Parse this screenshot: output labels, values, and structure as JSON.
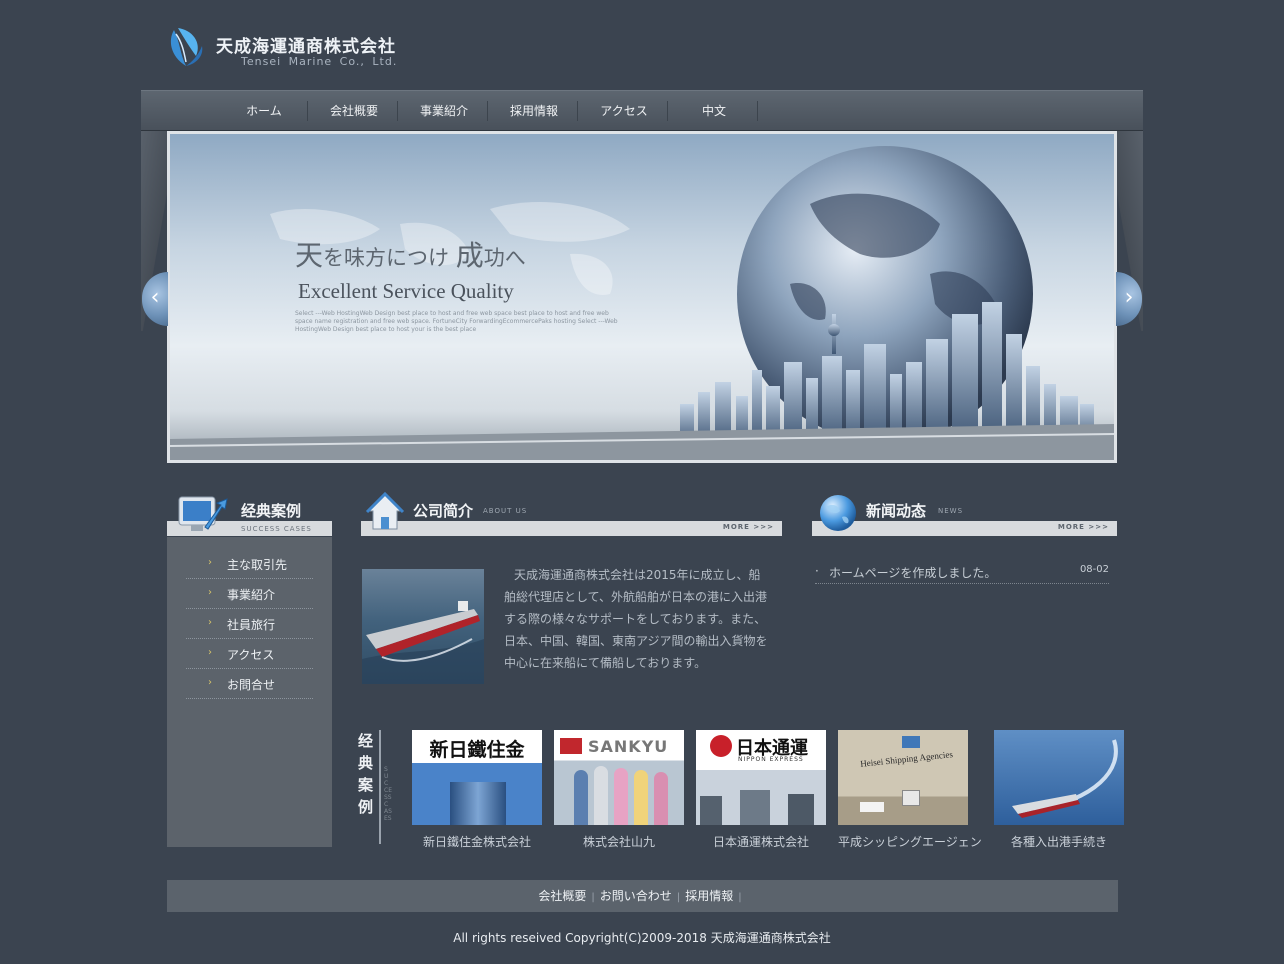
{
  "header": {
    "company_jp": "天成海運通商株式会社",
    "company_en": "Tensei Marine Co., Ltd."
  },
  "nav": {
    "items": [
      "ホーム",
      "会社概要",
      "事業紹介",
      "採用情報",
      "アクセス",
      "中文"
    ]
  },
  "banner": {
    "headline_1": "天",
    "headline_2": "を味方につけ ",
    "headline_3": "成",
    "headline_4": "功へ",
    "subtitle": "Excellent Service Quality",
    "small_text": "Select ---Web HostingWeb Design best place to host and free web space best place to host and free web space name registration and free web space. FortuneCity ForwardingEcommercePaks hosting Select ---Web HostingWeb Design best place to host your is the best place",
    "prev_glyph": "‹",
    "next_glyph": "›"
  },
  "cases_panel": {
    "title": "经典案例",
    "subtitle": "SUCCESS CASES",
    "items": [
      "主な取引先",
      "事業紹介",
      "社員旅行",
      "アクセス",
      "お問合せ"
    ]
  },
  "about": {
    "title": "公司简介",
    "subtitle": "ABOUT US",
    "more": "MORE >>>",
    "text": "天成海運通商株式会社は2015年に成立し、船舶総代理店として、外航船舶が日本の港に入出港する際の様々なサポートをしております。また、日本、中国、韓国、東南アジア間の輸出入貨物を中心に在来船にて備船しております。"
  },
  "news": {
    "title": "新闻动态",
    "subtitle": "NEWS",
    "more": "MORE >>>",
    "items": [
      {
        "text": "ホームページを作成しました。",
        "date": "08-02"
      }
    ]
  },
  "cases_strip": {
    "label_vertical": "经典案例",
    "label_sub": "SUCCESS CASES",
    "items": [
      {
        "caption": "新日鐵住金株式会社",
        "logo_text": "新日鐵住金"
      },
      {
        "caption": "株式会社山九",
        "logo_text": "SANKYU"
      },
      {
        "caption": "日本通運株式会社",
        "logo_text": "日本通運",
        "logo_sub": "NIPPON EXPRESS"
      },
      {
        "caption": "平成シッピングエージェン",
        "logo_text": "Heisei Shipping Agencies"
      },
      {
        "caption": "各種入出港手続き"
      }
    ]
  },
  "footer": {
    "links": [
      "会社概要",
      "お問い合わせ",
      "採用情報"
    ],
    "separator": "|",
    "copyright": "All rights reseived Copyright(C)2009-2018 天成海運通商株式会社"
  },
  "colors": {
    "page_bg": "#3b4450",
    "nav_bg": "#525a64",
    "panel_bg": "#5c636b",
    "accent_blue": "#5b8fc7"
  }
}
